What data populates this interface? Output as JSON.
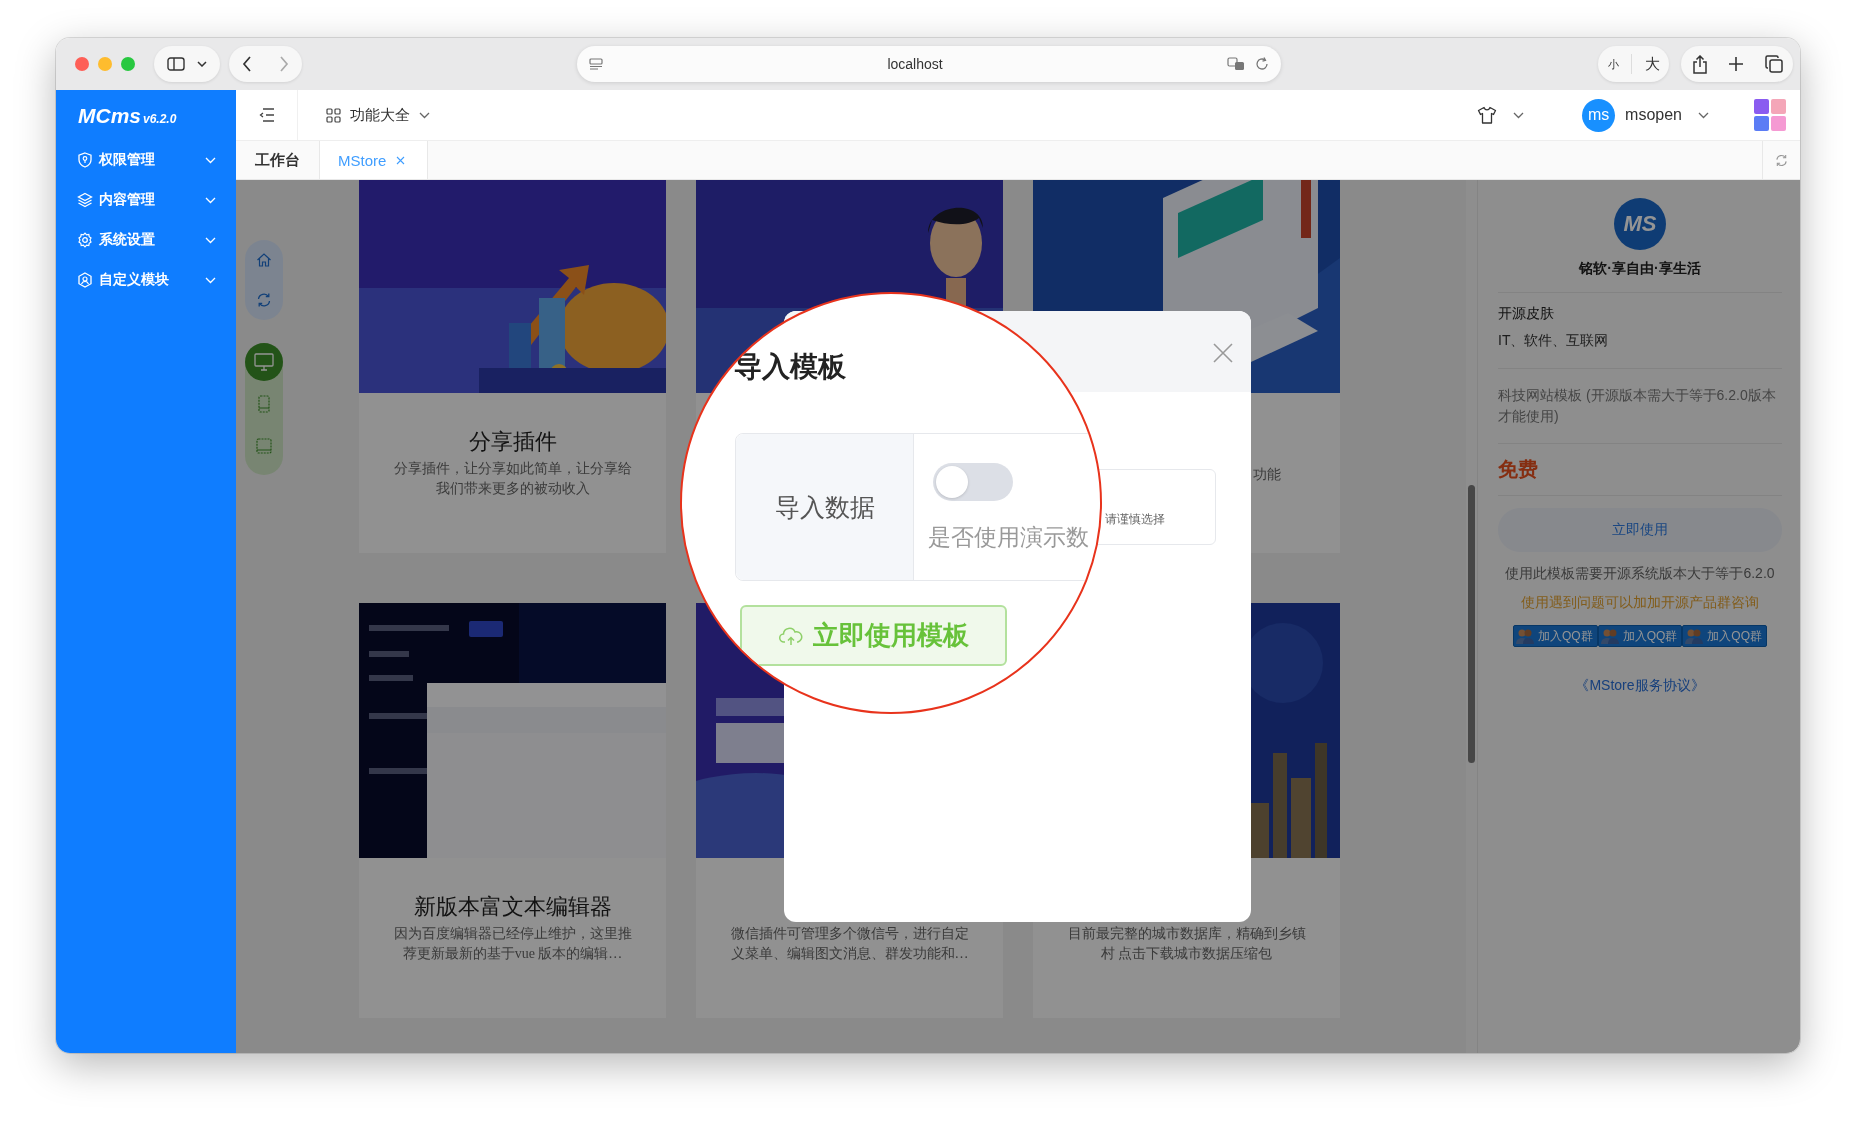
{
  "browser": {
    "url": "localhost",
    "text_size": [
      "小",
      "大"
    ]
  },
  "sidebar": {
    "logo": "MCms",
    "version": "v6.2.0",
    "items": [
      {
        "label": "权限管理",
        "kind": "shield"
      },
      {
        "label": "内容管理",
        "kind": "layers"
      },
      {
        "label": "系统设置",
        "kind": "gear"
      },
      {
        "label": "自定义模块",
        "kind": "cube"
      }
    ]
  },
  "header": {
    "menu": "功能大全",
    "user": {
      "avatar": "ms",
      "name": "msopen"
    }
  },
  "tabs": [
    {
      "label": "工作台",
      "selected": false,
      "closable": false
    },
    {
      "label": "MStore",
      "selected": true,
      "closable": true
    }
  ],
  "preview_devices": [
    {
      "kind": "desktop",
      "selected": true
    },
    {
      "kind": "phone",
      "selected": false
    },
    {
      "kind": "tablet",
      "selected": false
    }
  ],
  "cards": [
    {
      "image": {
        "kind": "picture"
      },
      "title": "分享插件",
      "description": "分享插件，让分享如此简单，让分享给我们带来更多的被动收入"
    },
    {
      "image": {
        "kind": "picture"
      }
    },
    {
      "image": {
        "kind": "picture"
      },
      "description": "功能"
    },
    {
      "image": {
        "kind": "picture"
      },
      "title": "新版本富文本编辑器",
      "description": "因为百度编辑器已经停止维护，这里推荐更新最新的基于vue 版本的编辑…"
    },
    {
      "image": {
        "kind": "picture"
      },
      "description": "微信插件可管理多个微信号，进行自定义菜单、编辑图文消息、群发功能和…"
    },
    {
      "image": {
        "kind": "picture"
      },
      "description": "目前最完整的城市数据库，精确到乡镇村 点击下载城市数据压缩包"
    }
  ],
  "detail": {
    "logo_text": "MS",
    "slogan": "铭软·享自由·享生活",
    "name": "开源皮肤",
    "category": "IT、软件、互联网",
    "summary": "科技网站模板 (开源版本需大于等于6.2.0版本才能使用)",
    "price": "免费",
    "use_button": "立即使用",
    "requirement": "使用此模板需要开源系统版本大于等于6.2.0",
    "help": "使用遇到问题可以加加开源产品群咨询",
    "qq_buttons": [
      "加入QQ群",
      "加入QQ群",
      "加入QQ群"
    ],
    "agreement_link": "《MStore服务协议》"
  },
  "modal": {
    "title": "导入模板",
    "field_label": "导入数据",
    "demo_data": {
      "on": false
    },
    "hint": "是否使用演示数",
    "note": "请谨慎选择",
    "submit": "立即使用模板"
  }
}
